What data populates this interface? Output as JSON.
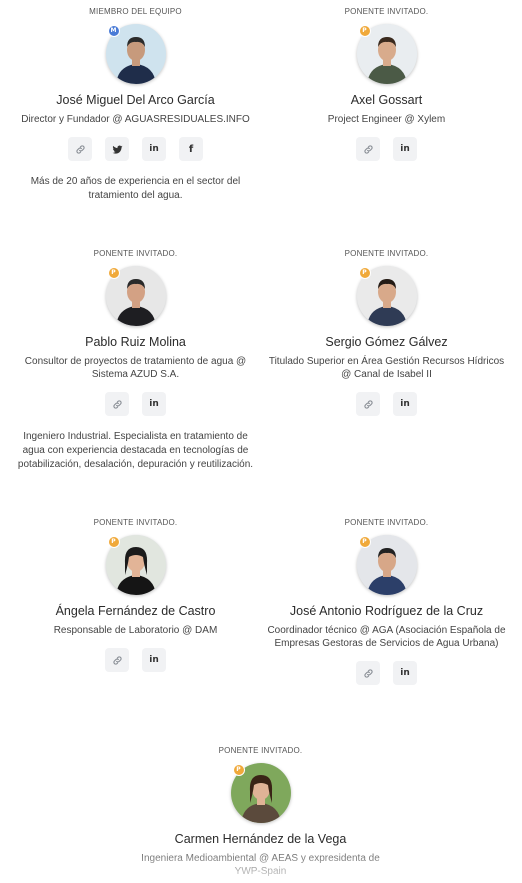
{
  "colors": {
    "badge_member": "#4a7bd6",
    "badge_speaker": "#f0a93a"
  },
  "speakers": [
    {
      "role": "MIEMBRO DEL EQUIPO",
      "badge": "M",
      "name": "José Miguel Del Arco García",
      "title": "Director y Fundador @ AGUASRESIDUALES.INFO",
      "socials": [
        "link-icon",
        "twitter-icon",
        "linkedin-icon",
        "facebook-icon"
      ],
      "bio": "Más de 20 años de experiencia en el sector del tratamiento del agua."
    },
    {
      "role": "PONENTE INVITADO.",
      "badge": "P",
      "name": "Axel Gossart",
      "title": "Project Engineer @ Xylem",
      "socials": [
        "link-icon",
        "linkedin-icon"
      ],
      "bio": ""
    },
    {
      "role": "PONENTE INVITADO.",
      "badge": "P",
      "name": "Pablo Ruiz Molina",
      "title": "Consultor de proyectos de tratamiento de agua @ Sistema AZUD S.A.",
      "socials": [
        "link-icon",
        "linkedin-icon"
      ],
      "bio": "Ingeniero Industrial. Especialista en tratamiento de agua con experiencia destacada en tecnologías de potabilización, desalación, depuración y reutilización."
    },
    {
      "role": "PONENTE INVITADO.",
      "badge": "P",
      "name": "Sergio Gómez Gálvez",
      "title": "Titulado Superior en Área Gestión Recursos Hídricos @ Canal de Isabel II",
      "socials": [
        "link-icon",
        "linkedin-icon"
      ],
      "bio": ""
    },
    {
      "role": "PONENTE INVITADO.",
      "badge": "P",
      "name": "Ángela Fernández de Castro",
      "title": "Responsable de Laboratorio @ DAM",
      "socials": [
        "link-icon",
        "linkedin-icon"
      ],
      "bio": ""
    },
    {
      "role": "PONENTE INVITADO.",
      "badge": "P",
      "name": "José Antonio Rodríguez de la Cruz",
      "title": "Coordinador técnico @ AGA (Asociación Española de Empresas Gestoras de Servicios de Agua Urbana)",
      "socials": [
        "link-icon",
        "linkedin-icon"
      ],
      "bio": ""
    },
    {
      "role": "PONENTE INVITADO.",
      "badge": "P",
      "name": "Carmen Hernández de la Vega",
      "title": "Ingeniera Medioambiental @ AEAS y expresidenta de YWP-Spain",
      "socials": [],
      "bio": ""
    }
  ]
}
